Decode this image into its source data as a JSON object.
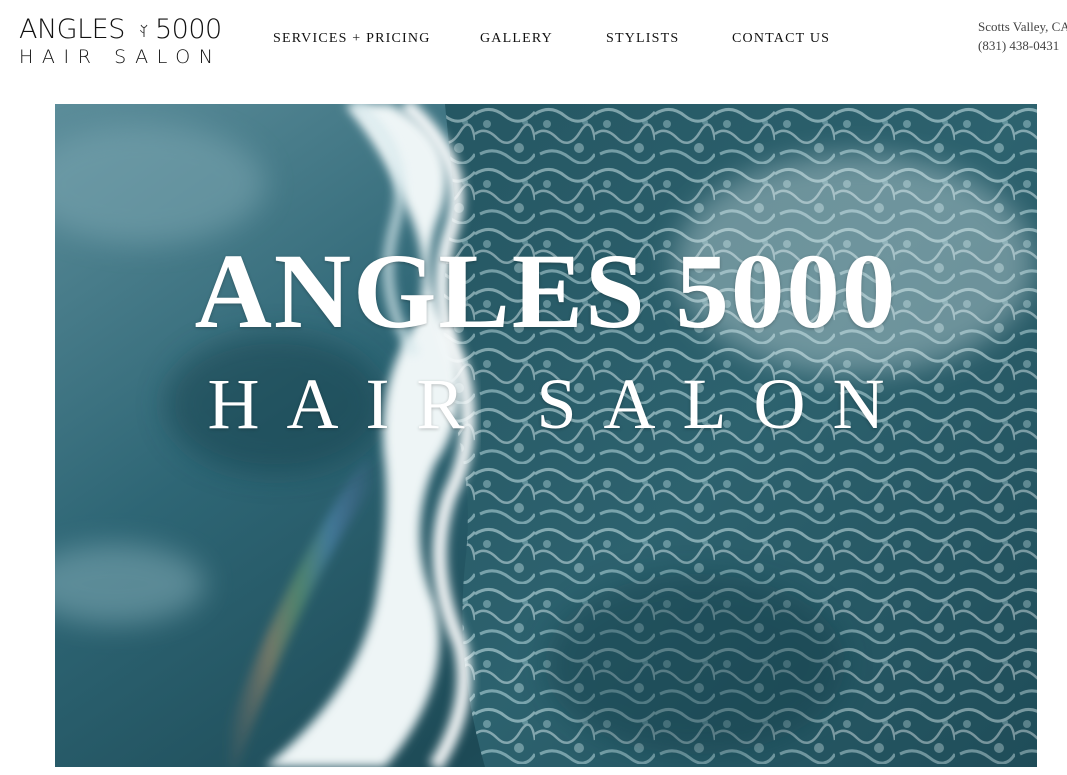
{
  "logo": {
    "line1_left": "ANGLES",
    "line1_right": "5000",
    "line2": "HAIR SALON"
  },
  "nav": {
    "items": [
      {
        "label": "SERVICES + PRICING"
      },
      {
        "label": "GALLERY"
      },
      {
        "label": "STYLISTS"
      },
      {
        "label": "CONTACT US"
      }
    ]
  },
  "contact": {
    "location": "Scotts Valley, CA",
    "phone": "(831) 438-0431"
  },
  "hero": {
    "title": "ANGLES 5000",
    "subtitle": "HAIR SALON",
    "background": "ocean-waves-aerial"
  },
  "colors": {
    "text": "#111111",
    "muted": "#444444",
    "hero_text": "#ffffff",
    "water_dark": "#1f4a55",
    "water_light": "#3d7c88",
    "foam": "#f2f6f7"
  }
}
